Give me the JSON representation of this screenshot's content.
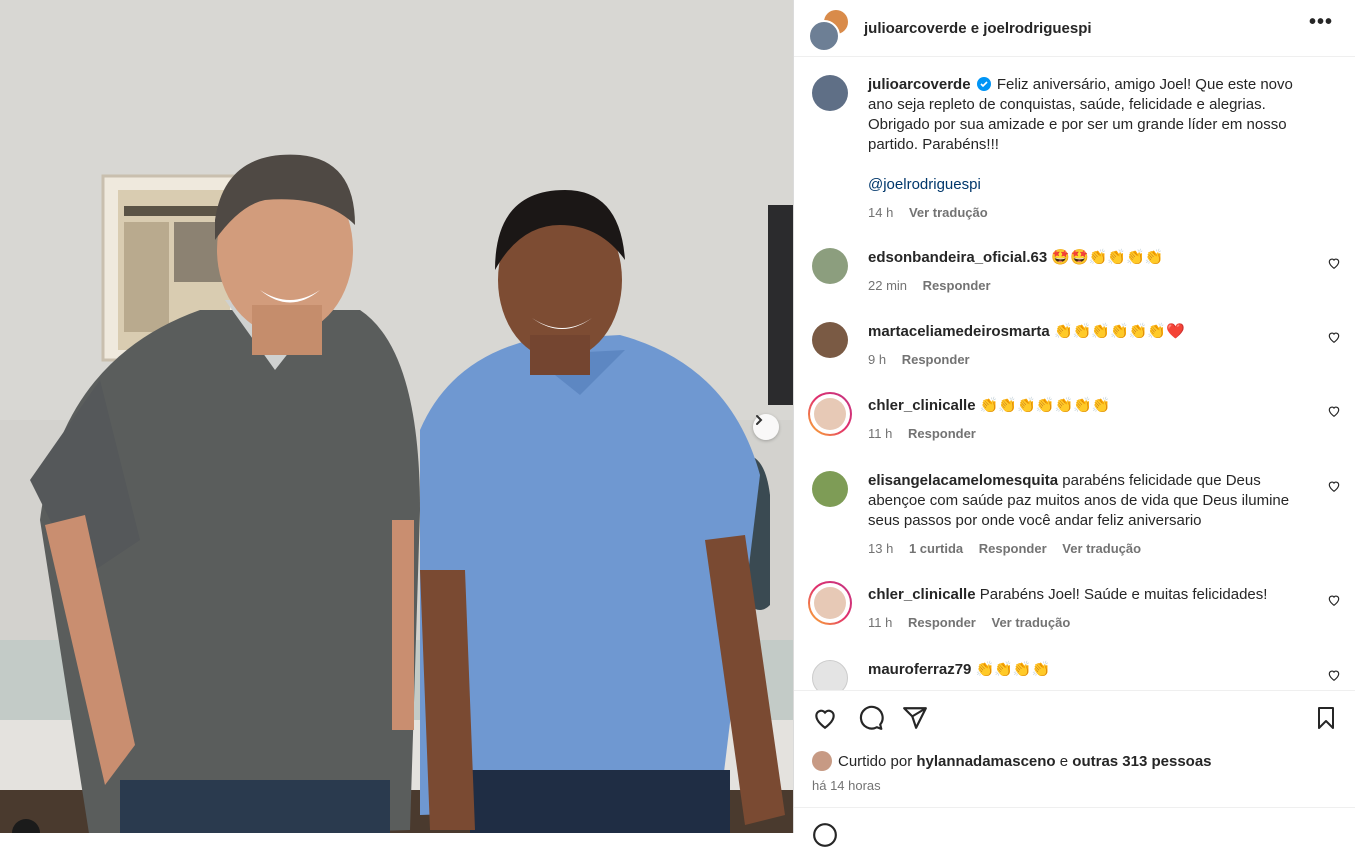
{
  "header": {
    "title": "julioarcoverde e joelrodriguespi",
    "more_label": "•••"
  },
  "caption": {
    "username": "julioarcoverde",
    "text": "Feliz aniversário, amigo Joel! Que este novo ano seja repleto de conquistas, saúde, felicidade e alegrias. Obrigado por sua amizade e por ser um grande líder em nosso partido. Parabéns!!!",
    "mention": "@joelrodriguespi",
    "time": "14 h",
    "translate": "Ver tradução"
  },
  "comments": [
    {
      "username": "edsonbandeira_oficial.63",
      "text": "🤩🤩👏👏👏👏",
      "time": "22 min",
      "likes": "",
      "reply": "Responder",
      "translate": ""
    },
    {
      "username": "martaceliamedeirosmarta",
      "text": "👏👏👏👏👏👏❤️",
      "time": "9 h",
      "likes": "",
      "reply": "Responder",
      "translate": ""
    },
    {
      "username": "chler_clinicalle",
      "text": "👏👏👏👏👏👏👏",
      "time": "11 h",
      "likes": "",
      "reply": "Responder",
      "translate": ""
    },
    {
      "username": "elisangelacamelomesquita",
      "text": "parabéns felicidade que Deus abençoe com saúde paz muitos anos de vida que Deus ilumine seus passos por onde você andar feliz aniversario",
      "time": "13 h",
      "likes": "1 curtida",
      "reply": "Responder",
      "translate": "Ver tradução"
    },
    {
      "username": "chler_clinicalle",
      "text": "Parabéns Joel! Saúde e muitas felicidades!",
      "time": "11 h",
      "likes": "",
      "reply": "Responder",
      "translate": "Ver tradução"
    },
    {
      "username": "mauroferraz79",
      "text": "👏👏👏👏",
      "time": "",
      "likes": "",
      "reply": "",
      "translate": ""
    }
  ],
  "likes": {
    "prefix": "Curtido por",
    "user": "hylannadamasceno",
    "joiner": "e",
    "others": "outras 313 pessoas"
  },
  "posted_time": "há 14 horas",
  "colors": {
    "accent_link": "#00376b",
    "verified": "#0095f6",
    "muted_text": "#737373",
    "heart_red": "#e0245e"
  }
}
